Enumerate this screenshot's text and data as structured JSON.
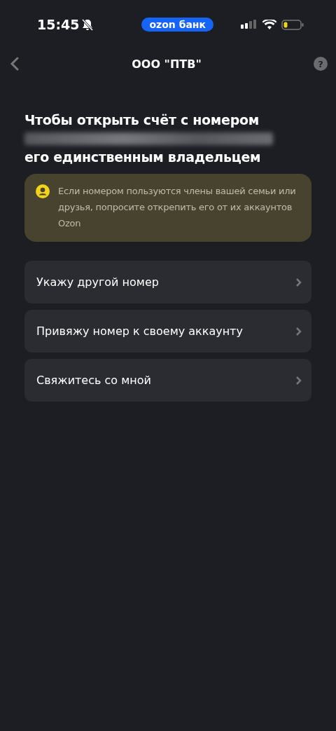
{
  "status_bar": {
    "time": "15:45",
    "app_badge": "ozon банк"
  },
  "header": {
    "title": "ООО \"ПТВ\"",
    "help_label": "?"
  },
  "heading": {
    "line_1": "Чтобы открыть счёт с номером",
    "line_3": "его единственным владельцем"
  },
  "notice": {
    "text": "Если номером пользуются члены вашей семьи или друзья, попросите открепить его от их аккаунтов Ozon"
  },
  "options": [
    {
      "label": "Укажу другой номер"
    },
    {
      "label": "Привяжу номер к своему аккаунту"
    },
    {
      "label": "Свяжитесь со мной"
    }
  ]
}
